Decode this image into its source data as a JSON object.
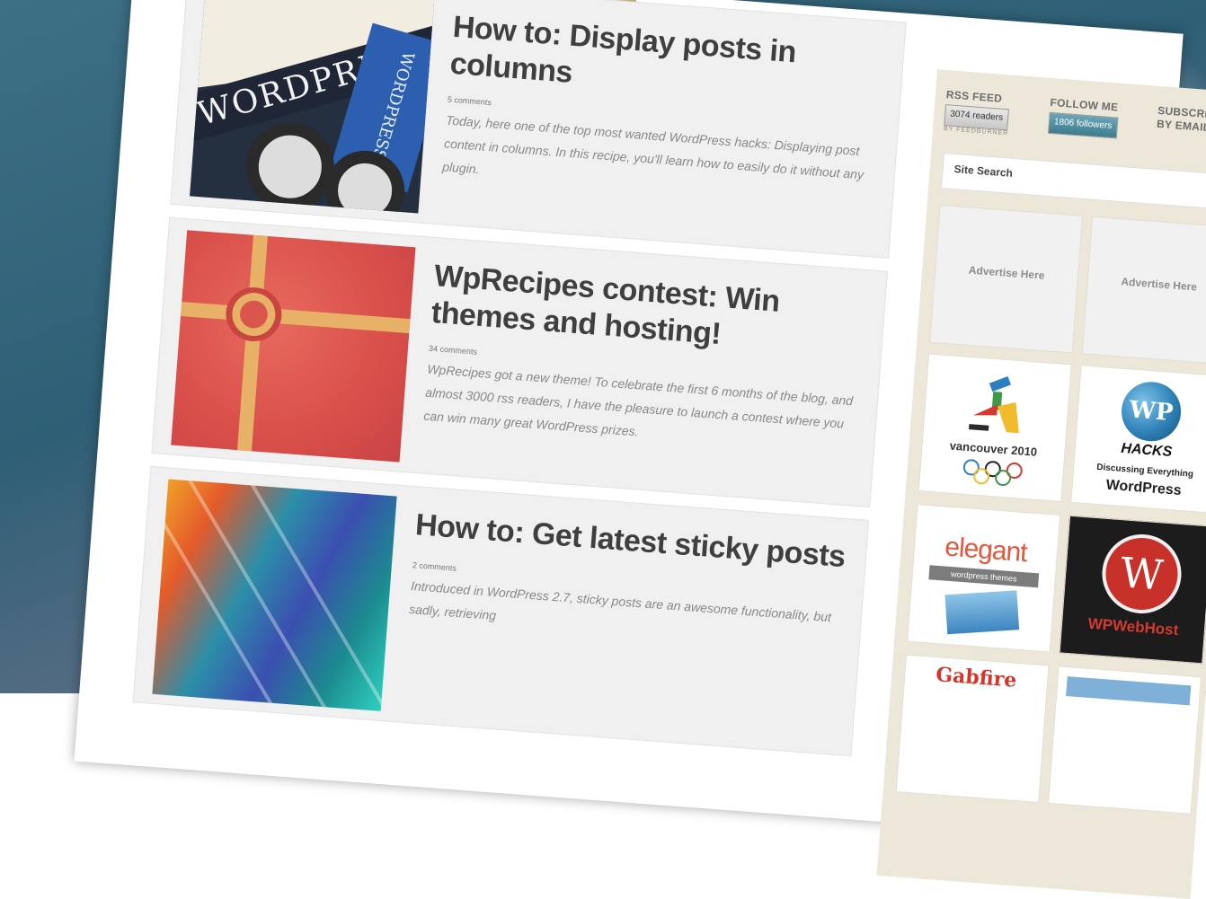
{
  "posts": [
    {
      "title": "How to: Display posts in columns",
      "comments": "5 comments",
      "excerpt": "Today, here one of the top most wanted WordPress hacks: Displaying post content in columns. In this recipe, you'll learn how to easily do it without any plugin."
    },
    {
      "title": "WpRecipes contest: Win themes and hosting!",
      "comments": "34 comments",
      "excerpt": "WpRecipes got a new theme! To celebrate the first 6 months of the blog, and almost 3000 rss readers, I have the pleasure to launch a contest where you can win many great WordPress prizes."
    },
    {
      "title": "How to: Get latest sticky posts",
      "comments": "2 comments",
      "excerpt": "Introduced in WordPress 2.7, sticky posts are an awesome functionality, but sadly, retrieving"
    }
  ],
  "sidebar": {
    "rss_label": "RSS FEED",
    "rss_count": "3074",
    "rss_unit": "readers",
    "rss_by": "BY FEEDBURNER",
    "follow_label": "FOLLOW ME",
    "follow_count": "1806",
    "follow_unit": "followers",
    "subscribe_label": "SUBSCRIBE BY EMAIL",
    "search_placeholder": "Site Search",
    "ad_text": "Advertise Here",
    "sponsors": {
      "vancouver": "vancouver 2010",
      "wphacks_logo": "WP",
      "wphacks_name": "HACKS",
      "wphacks_sub": "Discussing Everything",
      "wphacks_wp": "WordPress",
      "elegant": "elegant",
      "elegant_sub": "wordpress themes",
      "wpwebhost_logo": "W",
      "wpwebhost": "WPWebHost",
      "gabfire": "Gabfire"
    }
  },
  "colors": {
    "title": "#3f3f3f",
    "excerpt": "#888888",
    "sidebar_bg": "#ece7d8",
    "post_bg": "#f0f0f0"
  }
}
